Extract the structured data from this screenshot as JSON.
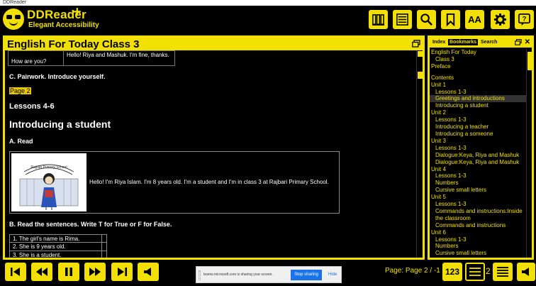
{
  "window": {
    "title": "DDReader"
  },
  "brand": {
    "name": "DDReader",
    "plus": "+",
    "tagline": "Elegant Accessibility"
  },
  "header": {
    "font_label": "AA",
    "icons": [
      "library-icon",
      "menu-list-icon",
      "search-icon",
      "bookmark-icon",
      "font-size-icon",
      "settings-icon",
      "help-icon"
    ]
  },
  "main": {
    "title": "English For Today Class 3",
    "table_top": {
      "question": "How are you?",
      "answer": "Hello! Riya and Mashuk. I'm fine, thanks."
    },
    "pairwork": "C. Pairwork. Introduce yourself.",
    "page_marker": "Page 2",
    "lessons": "Lessons 4-6",
    "section_heading": "Introducing a student",
    "read_label": "A. Read",
    "read_text": "Hello! I'm Riya Islam. I'm 8 years old. I'm a student and I'm in class 3 at Rajbari Primary School.",
    "image_sign": "Rajbari Primary School",
    "tf_instruction": "B. Read the sentences. Write T for True or F for False.",
    "tf_rows": [
      "1. The girl's name is Rima.",
      "2. She is 9 years old.",
      "3. She is a student."
    ]
  },
  "side": {
    "tabs": [
      "Index",
      "Bookmarks",
      "Search"
    ],
    "active_tab": "Index",
    "close": "✕",
    "toc": [
      {
        "label": "English For Today",
        "level": 0
      },
      {
        "label": "Class 3",
        "level": 1
      },
      {
        "label": "Preface",
        "level": 0
      },
      {
        "label": "",
        "level": -1
      },
      {
        "label": "Contents",
        "level": 0
      },
      {
        "label": "Unit 1",
        "level": 0
      },
      {
        "label": "Lessons 1-3",
        "level": 1
      },
      {
        "label": "Greetings and introductions",
        "level": 1,
        "selected": true
      },
      {
        "label": "Introducing a student",
        "level": 1
      },
      {
        "label": "Unit 2",
        "level": 0
      },
      {
        "label": "Lessons 1-3",
        "level": 1
      },
      {
        "label": "Introducing a teacher",
        "level": 1
      },
      {
        "label": "Introducing a someone",
        "level": 1
      },
      {
        "label": "Unit 3",
        "level": 0
      },
      {
        "label": "Lessons 1-3",
        "level": 1
      },
      {
        "label": "Dialogue:Keya, Riya and Mashuk",
        "level": 1
      },
      {
        "label": "Dialogue:Keya, Riya and Mashuk",
        "level": 1
      },
      {
        "label": "Unit 4",
        "level": 0
      },
      {
        "label": "Lessons 1-3",
        "level": 1
      },
      {
        "label": "Numbers",
        "level": 1
      },
      {
        "label": "Cursive small letters",
        "level": 1
      },
      {
        "label": "Unit 5",
        "level": 0
      },
      {
        "label": "Lessons 1-3",
        "level": 1
      },
      {
        "label": "Commands and instructions:Inside the classroom",
        "level": 1,
        "wrap": true
      },
      {
        "label": "Commands and instructions",
        "level": 1
      },
      {
        "label": "Unit 6",
        "level": 0
      },
      {
        "label": "Lessons 1-3",
        "level": 1
      },
      {
        "label": "Numbers",
        "level": 1
      },
      {
        "label": "Cursive small letters",
        "level": 1
      }
    ]
  },
  "bottom": {
    "page_label": "Page: Page 2 / -1",
    "page_button": "123",
    "level_number": "2",
    "nav_icons": [
      "skip-to-start-icon",
      "rewind-icon",
      "pause-icon",
      "fast-forward-icon",
      "skip-to-end-icon",
      "speaker-icon"
    ]
  },
  "share": {
    "text": "teams.microsoft.com is sharing your screen.",
    "stop_label": "Stop sharing",
    "hide_label": "Hide"
  },
  "colors": {
    "accent": "#f2e000",
    "background": "#000000",
    "share_button": "#1a73e8"
  }
}
